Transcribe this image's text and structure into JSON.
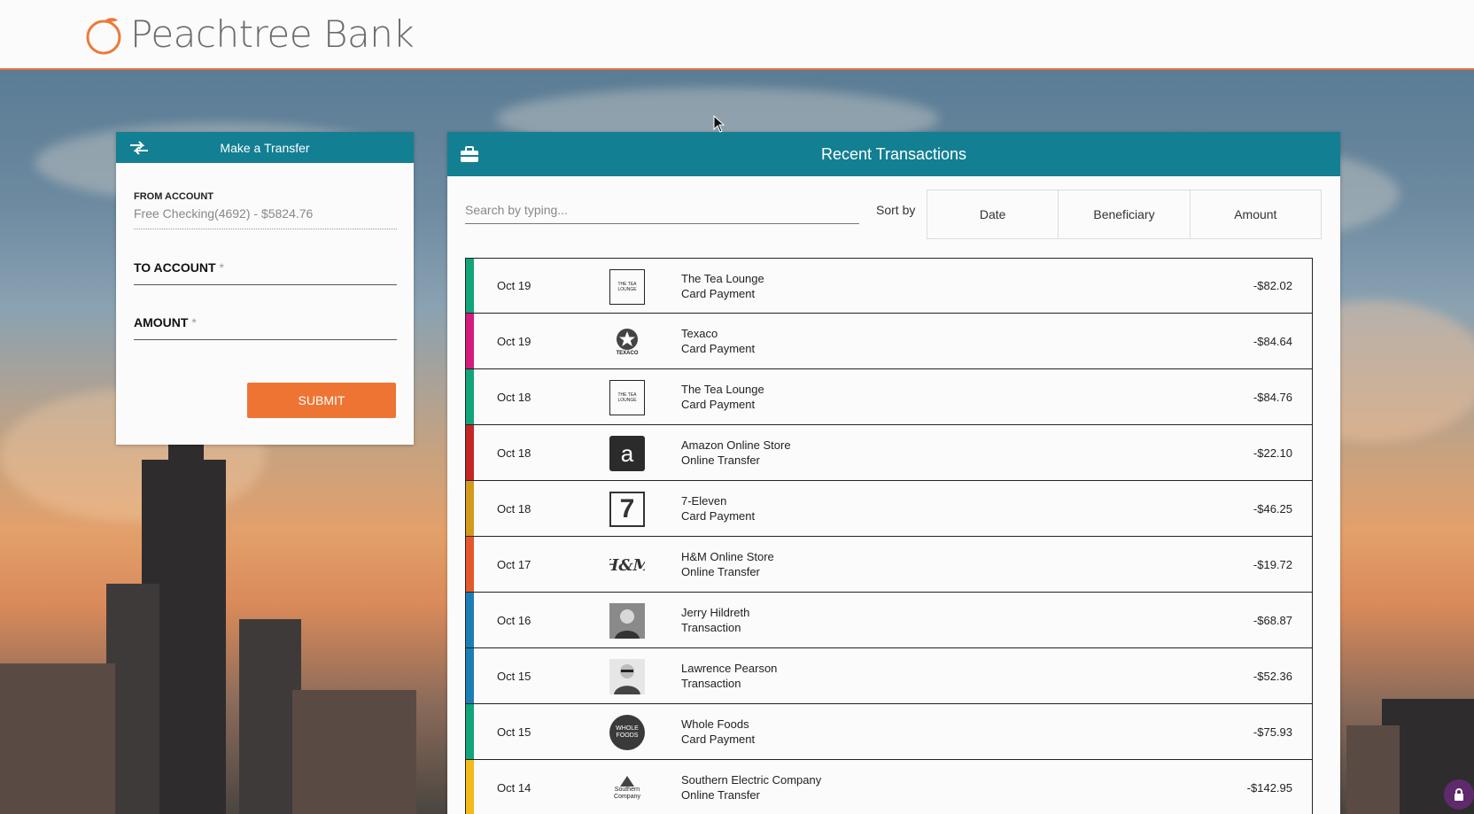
{
  "brand": {
    "name": "Peachtree Bank",
    "accent": "#e8743b"
  },
  "transfer": {
    "title": "Make a Transfer",
    "from_label": "FROM ACCOUNT",
    "from_value": "Free Checking(4692) - $5824.76",
    "to_label": "TO ACCOUNT",
    "amount_label": "AMOUNT",
    "required_mark": "*",
    "submit_label": "SUBMIT",
    "header_color": "#137f93",
    "button_color": "#ee7434"
  },
  "transactions": {
    "title": "Recent Transactions",
    "search_placeholder": "Search by typing...",
    "sort_label": "Sort by",
    "sort_options": [
      "Date",
      "Beneficiary",
      "Amount"
    ],
    "rows": [
      {
        "date": "Oct 19",
        "merchant": "The Tea Lounge",
        "type": "Card Payment",
        "amount": "-$82.02",
        "color": "#12a579",
        "logo": "tea-lounge-logo"
      },
      {
        "date": "Oct 19",
        "merchant": "Texaco",
        "type": "Card Payment",
        "amount": "-$84.64",
        "color": "#d51b7e",
        "logo": "texaco-logo"
      },
      {
        "date": "Oct 18",
        "merchant": "The Tea Lounge",
        "type": "Card Payment",
        "amount": "-$84.76",
        "color": "#12a579",
        "logo": "tea-lounge-logo"
      },
      {
        "date": "Oct 18",
        "merchant": "Amazon Online Store",
        "type": "Online Transfer",
        "amount": "-$22.10",
        "color": "#c42626",
        "logo": "amazon-logo"
      },
      {
        "date": "Oct 18",
        "merchant": "7-Eleven",
        "type": "Card Payment",
        "amount": "-$46.25",
        "color": "#d29b1b",
        "logo": "seven-eleven-logo"
      },
      {
        "date": "Oct 17",
        "merchant": "H&M Online Store",
        "type": "Online Transfer",
        "amount": "-$19.72",
        "color": "#e5582b",
        "logo": "hm-logo"
      },
      {
        "date": "Oct 16",
        "merchant": "Jerry Hildreth",
        "type": "Transaction",
        "amount": "-$68.87",
        "color": "#1b7fb5",
        "logo": "jerry-avatar"
      },
      {
        "date": "Oct 15",
        "merchant": "Lawrence Pearson",
        "type": "Transaction",
        "amount": "-$52.36",
        "color": "#1b7fb5",
        "logo": "lawrence-avatar"
      },
      {
        "date": "Oct 15",
        "merchant": "Whole Foods",
        "type": "Card Payment",
        "amount": "-$75.93",
        "color": "#12a579",
        "logo": "whole-foods-logo"
      },
      {
        "date": "Oct 14",
        "merchant": "Southern Electric Company",
        "type": "Online Transfer",
        "amount": "-$142.95",
        "color": "#f2bb1a",
        "logo": "southern-company-logo"
      }
    ],
    "logo_text": {
      "tea": "THE TEA LOUNGE",
      "texaco": "TEXACO",
      "amazon": "a",
      "seven": "7",
      "hm": "H&M",
      "whole": "WHOLE FOODS",
      "southern": "Southern Company"
    }
  }
}
